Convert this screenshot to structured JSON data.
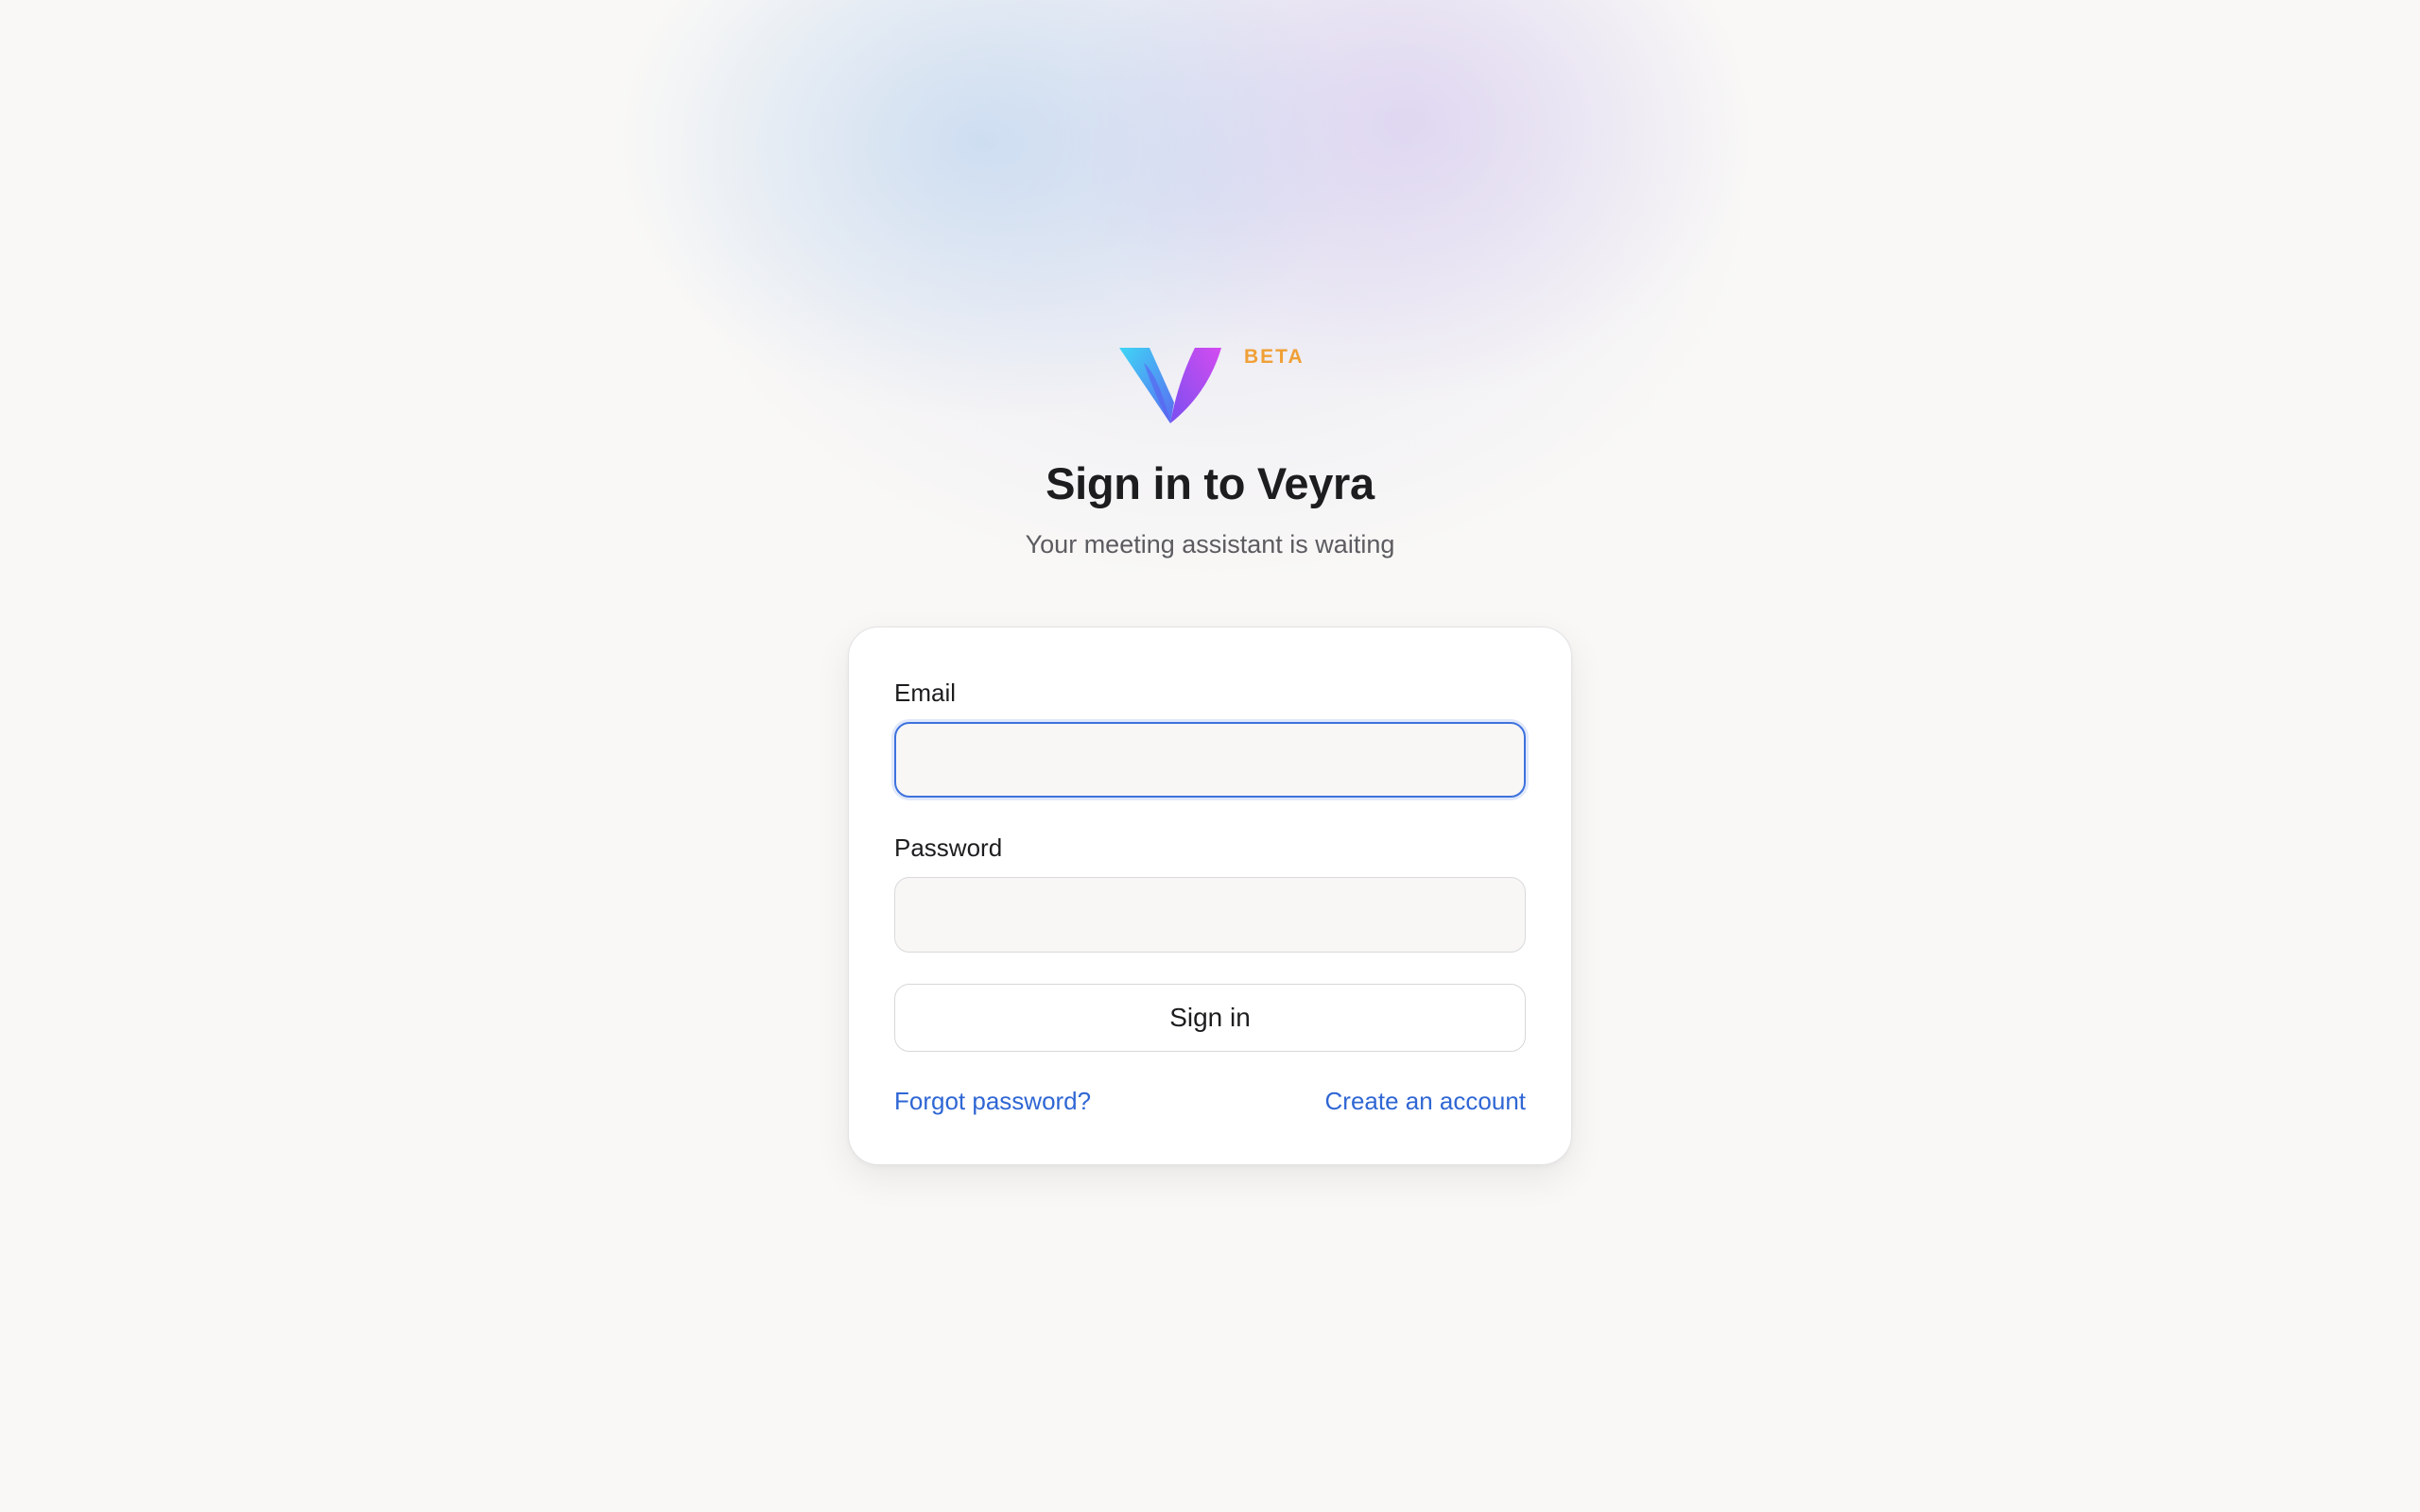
{
  "brand": {
    "logo_icon": "veyra-v-logo-icon",
    "badge": "BETA",
    "badge_color": "#f0a035",
    "gradient_colors": [
      "#3fd6f5",
      "#6a5cf0",
      "#c445ee"
    ]
  },
  "header": {
    "title": "Sign in to Veyra",
    "subtitle": "Your meeting assistant is waiting"
  },
  "form": {
    "email": {
      "label": "Email",
      "value": "",
      "placeholder": ""
    },
    "password": {
      "label": "Password",
      "value": "",
      "placeholder": ""
    },
    "submit_label": "Sign in",
    "forgot_password": "Forgot password?",
    "create_account": "Create an account"
  },
  "colors": {
    "accent": "#3e72dd",
    "link": "#2f66d4",
    "background": "#f9f8f6"
  }
}
